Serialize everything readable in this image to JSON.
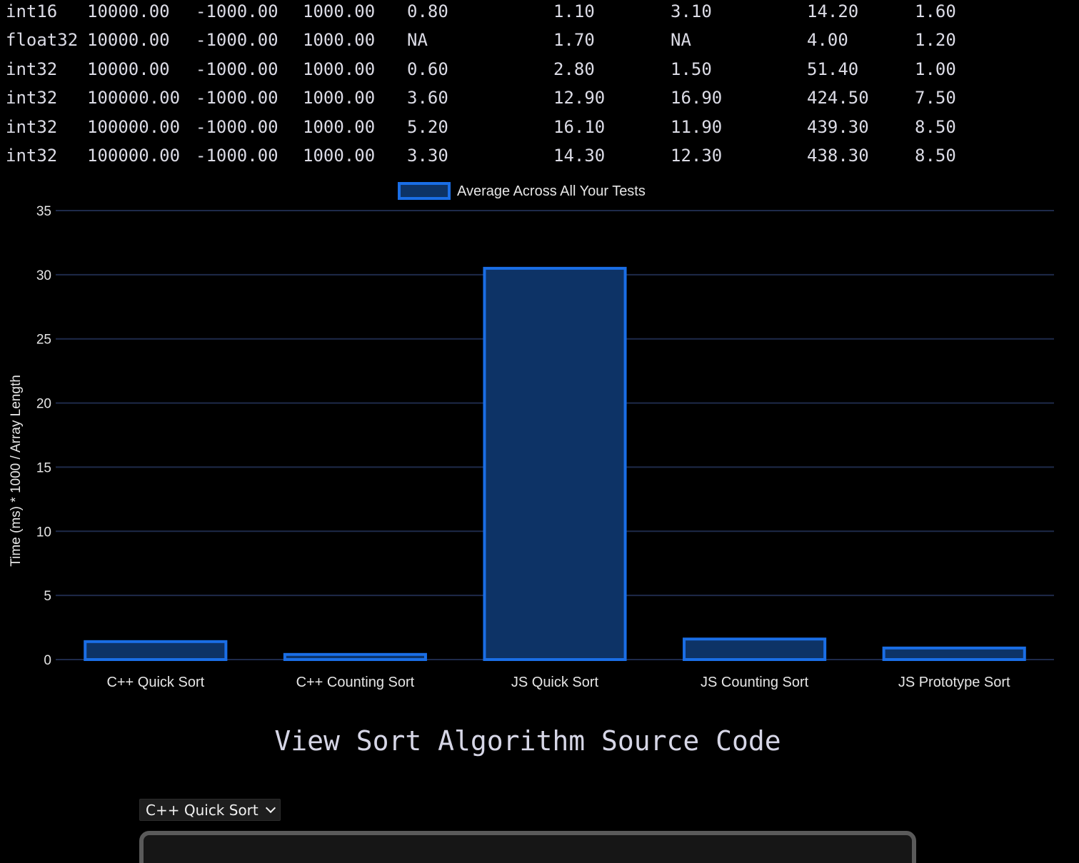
{
  "results_table": {
    "rows": [
      [
        "int16",
        "10000.00",
        "-1000.00",
        "1000.00",
        "0.80",
        "1.10",
        "3.10",
        "14.20",
        "1.60"
      ],
      [
        "float32",
        "10000.00",
        "-1000.00",
        "1000.00",
        "NA",
        "1.70",
        "NA",
        "4.00",
        "1.20"
      ],
      [
        "int32",
        "10000.00",
        "-1000.00",
        "1000.00",
        "0.60",
        "2.80",
        "1.50",
        "51.40",
        "1.00"
      ],
      [
        "int32",
        "100000.00",
        "-1000.00",
        "1000.00",
        "3.60",
        "12.90",
        "16.90",
        "424.50",
        "7.50"
      ],
      [
        "int32",
        "100000.00",
        "-1000.00",
        "1000.00",
        "5.20",
        "16.10",
        "11.90",
        "439.30",
        "8.50"
      ],
      [
        "int32",
        "100000.00",
        "-1000.00",
        "1000.00",
        "3.30",
        "14.30",
        "12.30",
        "438.30",
        "8.50"
      ]
    ]
  },
  "chart_data": {
    "type": "bar",
    "categories": [
      "C++ Quick Sort",
      "C++ Counting Sort",
      "JS Quick Sort",
      "JS Counting Sort",
      "JS Prototype Sort"
    ],
    "series": [
      {
        "name": "Average Across All Your Tests",
        "values": [
          1.4,
          0.4,
          30.5,
          1.6,
          0.9
        ]
      }
    ],
    "xlabel": "",
    "ylabel": "Time (ms) * 1000 / Array Length",
    "ylim": [
      0,
      35
    ],
    "yticks": [
      0,
      5,
      10,
      15,
      20,
      25,
      30,
      35
    ],
    "grid": true,
    "legend_position": "top-center",
    "colors": {
      "bar_fill": "#0d3366",
      "bar_border": "#1a6ee6",
      "grid": "#1e2a4a"
    }
  },
  "source_section": {
    "title": "View Sort Algorithm Source Code",
    "selected_algorithm": "C++ Quick Sort",
    "chevron_icon": "chevron-down-icon"
  }
}
